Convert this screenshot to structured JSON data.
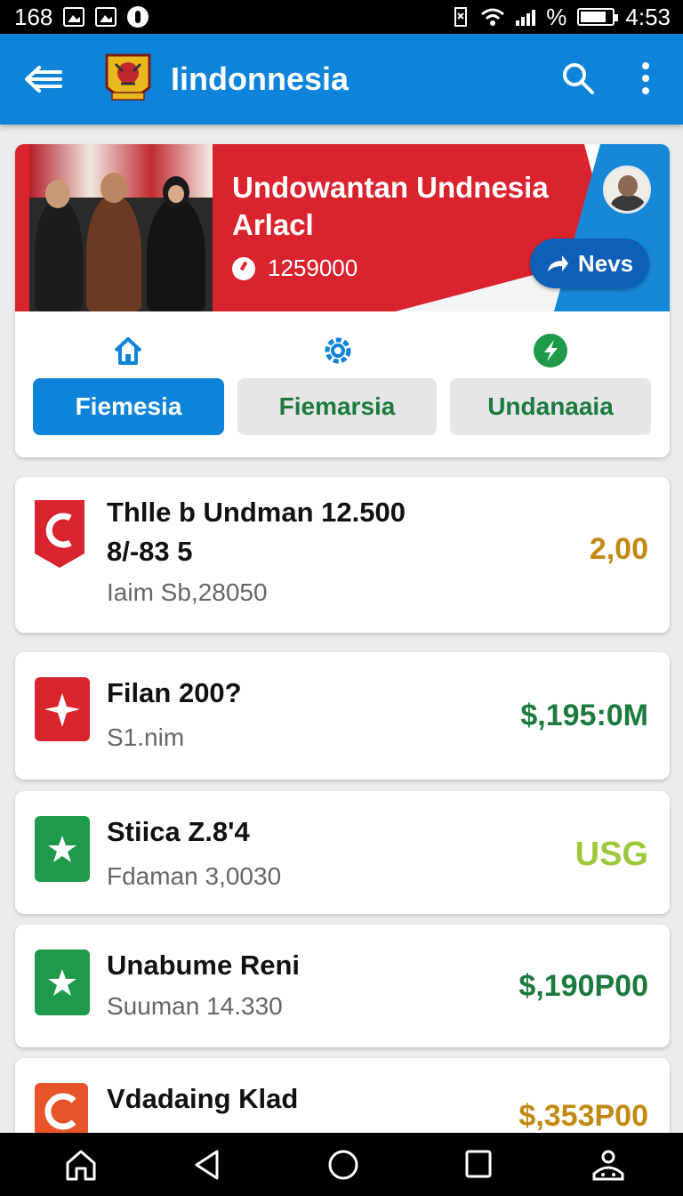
{
  "status_bar": {
    "left_text": "168",
    "time": "4:53",
    "percent": "%"
  },
  "app_bar": {
    "title": "Iindonnesia"
  },
  "hero": {
    "title": "Undowantan Undnesia Arlacl",
    "count": "1259000",
    "news_button": "Nevs"
  },
  "tabs": [
    {
      "label": "Fiemesia",
      "icon": "home-icon",
      "active": true
    },
    {
      "label": "Fiemarsia",
      "icon": "gear-icon",
      "active": false
    },
    {
      "label": "Undanaaia",
      "icon": "lightning-icon",
      "active": false
    }
  ],
  "items": [
    {
      "title_line1": "Thlle b Undman 12.500",
      "title_line2": "8/-83 5",
      "subtitle": "Iaim Sb,28050",
      "amount": "2,00",
      "amount_color": "#c28a12",
      "icon": "shield-c-icon",
      "icon_color": "#d9232e"
    },
    {
      "title_line1": "Filan 200?",
      "subtitle": "S1.nim",
      "amount": "$,195:0M",
      "amount_color": "#1b7a3c",
      "icon": "star-icon",
      "icon_color": "#d9232e"
    },
    {
      "title_line1": "Stiica Z.8'4",
      "subtitle": "Fdaman 3,0030",
      "amount": "USG",
      "amount_color": "#9bc93a",
      "icon": "star-icon",
      "icon_color": "#1f9a4a"
    },
    {
      "title_line1": "Unabume Reni",
      "subtitle": "Suuman 14.330",
      "amount": "$,190P00",
      "amount_color": "#1b7a3c",
      "icon": "star-icon",
      "icon_color": "#1f9a4a"
    },
    {
      "title_line1": "Vdadaing Klad",
      "subtitle": "",
      "amount": "$,353P00",
      "amount_color": "#c28a12",
      "icon": "c-logo-icon",
      "icon_color": "#e8542a"
    }
  ]
}
